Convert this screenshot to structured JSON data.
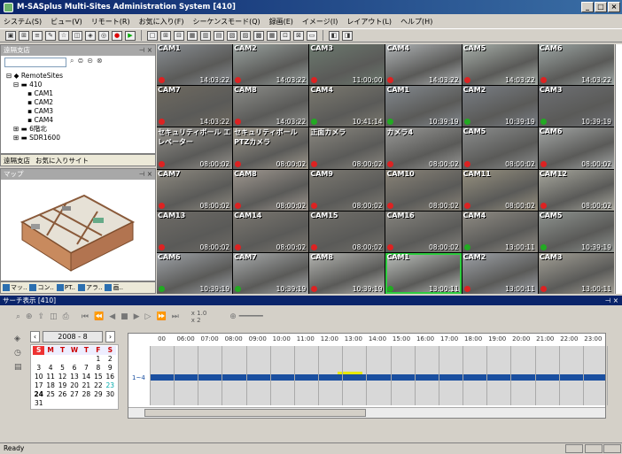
{
  "window": {
    "title": "M-SASplus Multi-Sites Administration System [410]",
    "min": "_",
    "max": "□",
    "close": "×"
  },
  "menu": [
    "システム(S)",
    "ビュー(V)",
    "リモート(R)",
    "お気に入り(F)",
    "シーケンスモード(Q)",
    "録画(E)",
    "イメージ(I)",
    "レイアウト(L)",
    "ヘルプ(H)"
  ],
  "left": {
    "tree_title": "遠隔支店",
    "tree": [
      "RemoteSites",
      "410",
      "CAM1",
      "CAM2",
      "CAM3",
      "CAM4",
      "6階北",
      "SDR1600"
    ],
    "tabs": [
      "遠隔支店",
      "お気に入りサイト"
    ],
    "map_title": "マップ",
    "bottom_tabs": [
      "マッ..",
      "コン..",
      "PT..",
      "アラ..",
      "画.."
    ]
  },
  "cameras": [
    {
      "name": "CAM1",
      "time": "14:03:22",
      "status": "red",
      "color": "#8a8f94"
    },
    {
      "name": "CAM2",
      "time": "14:03:22",
      "status": "red",
      "color": "#9aa3a0"
    },
    {
      "name": "CAM3",
      "time": "11:00:00",
      "status": "red",
      "color": "#6c7a6f"
    },
    {
      "name": "CAM4",
      "time": "14:03:22",
      "status": "red",
      "color": "#b0b4b6"
    },
    {
      "name": "CAM5",
      "time": "14:03:22",
      "status": "red",
      "color": "#a8b0aa"
    },
    {
      "name": "CAM6",
      "time": "14:03:22",
      "status": "red",
      "color": "#9da6a4"
    },
    {
      "name": "CAM7",
      "time": "14:03:22",
      "status": "red",
      "color": "#6f6a60"
    },
    {
      "name": "CAM8",
      "time": "14:03:22",
      "status": "red",
      "color": "#8d8e8a"
    },
    {
      "name": "CAM4",
      "time": "10:41:14",
      "status": "green",
      "color": "#7c7a70"
    },
    {
      "name": "CAM1",
      "time": "10:39:19",
      "status": "green",
      "color": "#848a90"
    },
    {
      "name": "CAM2",
      "time": "10:39:19",
      "status": "green",
      "color": "#7a7f86"
    },
    {
      "name": "CAM3",
      "time": "10:39:19",
      "status": "green",
      "color": "#6e7074"
    },
    {
      "name": "セキュリティボール エレベーター",
      "time": "08:00:02",
      "status": "red",
      "color": "#95928c"
    },
    {
      "name": "セキュリティボール PTZカメラ",
      "time": "08:00:02",
      "status": "red",
      "color": "#a09a8e"
    },
    {
      "name": "正面カメラ",
      "time": "08:00:02",
      "status": "red",
      "color": "#8b8880"
    },
    {
      "name": "カメラ4",
      "time": "08:00:02",
      "status": "red",
      "color": "#9a9a98"
    },
    {
      "name": "CAM5",
      "time": "08:00:02",
      "status": "red",
      "color": "#8c8e8e"
    },
    {
      "name": "CAM6",
      "time": "08:00:02",
      "status": "red",
      "color": "#a4a7a6"
    },
    {
      "name": "CAM7",
      "time": "08:00:02",
      "status": "red",
      "color": "#8e8a80"
    },
    {
      "name": "CAM8",
      "time": "08:00:02",
      "status": "red",
      "color": "#a09890"
    },
    {
      "name": "CAM9",
      "time": "08:00:02",
      "status": "red",
      "color": "#7d7a72"
    },
    {
      "name": "CAM10",
      "time": "08:00:02",
      "status": "red",
      "color": "#8a8478"
    },
    {
      "name": "CAM11",
      "time": "08:00:02",
      "status": "red",
      "color": "#989280"
    },
    {
      "name": "CAM12",
      "time": "08:00:02",
      "status": "red",
      "color": "#a8a89e"
    },
    {
      "name": "CAM13",
      "time": "08:00:02",
      "status": "red",
      "color": "#6e6b66"
    },
    {
      "name": "CAM14",
      "time": "08:00:02",
      "status": "red",
      "color": "#7b7770"
    },
    {
      "name": "CAM15",
      "time": "08:00:02",
      "status": "red",
      "color": "#72706a"
    },
    {
      "name": "CAM16",
      "time": "08:00:02",
      "status": "red",
      "color": "#86847e"
    },
    {
      "name": "CAM4",
      "time": "13:00:11",
      "status": "green",
      "color": "#908c84"
    },
    {
      "name": "CAM5",
      "time": "10:39:19",
      "status": "green",
      "color": "#8f9490"
    },
    {
      "name": "CAM6",
      "time": "10:39:19",
      "status": "green",
      "color": "#9fa3a8"
    },
    {
      "name": "CAM7",
      "time": "10:39:19",
      "status": "green",
      "color": "#a9acad"
    },
    {
      "name": "CAM8",
      "time": "10:39:19",
      "status": "red",
      "color": "#b5b6b2"
    },
    {
      "name": "CAM1",
      "time": "13:00:11",
      "status": "green",
      "color": "#c0c4c0",
      "selected": true
    },
    {
      "name": "CAM2",
      "time": "13:00:11",
      "status": "red",
      "color": "#9ea2a8"
    },
    {
      "name": "CAM3",
      "time": "13:00:11",
      "status": "red",
      "color": "#a3a096"
    }
  ],
  "search": {
    "title": "サーチ表示 [410]",
    "speed1": "x 1.0",
    "speed2": "x 2",
    "month": "2008 - 8",
    "dow": [
      "S",
      "M",
      "T",
      "W",
      "T",
      "F",
      "S"
    ],
    "weeks": [
      [
        "",
        "",
        "",
        "",
        "",
        "1",
        "2"
      ],
      [
        "3",
        "4",
        "5",
        "6",
        "7",
        "8",
        "9"
      ],
      [
        "10",
        "11",
        "12",
        "13",
        "14",
        "15",
        "16"
      ],
      [
        "17",
        "18",
        "19",
        "20",
        "21",
        "22",
        "23"
      ],
      [
        "24",
        "25",
        "26",
        "27",
        "28",
        "29",
        "30"
      ],
      [
        "31",
        "",
        "",
        "",
        "",
        "",
        ""
      ]
    ],
    "hours": [
      "00",
      "06:00",
      "07:00",
      "08:00",
      "09:00",
      "10:00",
      "11:00",
      "12:00",
      "13:00",
      "14:00",
      "15:00",
      "16:00",
      "17:00",
      "18:00",
      "19:00",
      "20:00",
      "21:00",
      "22:00",
      "23:00"
    ],
    "channel": "1~4"
  },
  "status": "Ready"
}
